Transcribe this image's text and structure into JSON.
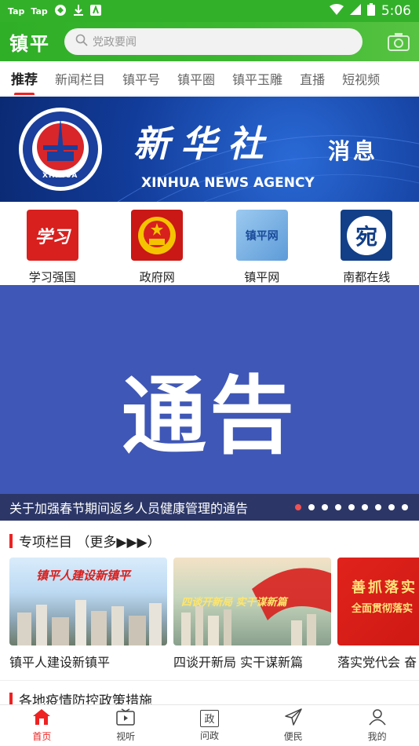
{
  "status_bar": {
    "tap1": "Tap",
    "tap2": "Tap",
    "time": "5:06"
  },
  "header": {
    "logo": "镇平",
    "search_placeholder": "党政要闻"
  },
  "tabs": [
    {
      "label": "推荐",
      "active": true
    },
    {
      "label": "新闻栏目"
    },
    {
      "label": "镇平号"
    },
    {
      "label": "镇平圈"
    },
    {
      "label": "镇平玉雕"
    },
    {
      "label": "直播"
    },
    {
      "label": "短视频"
    }
  ],
  "banner_xinhua": {
    "title": "新华社",
    "message": "消息",
    "english": "XINHUA NEWS AGENCY",
    "emblem_text": "XINHUA"
  },
  "quick_links": [
    {
      "label": "学习强国",
      "icon": "xuexi-icon",
      "icon_text": "学习"
    },
    {
      "label": "政府网",
      "icon": "national-emblem-icon"
    },
    {
      "label": "镇平网",
      "icon": "zhenping-net-icon",
      "icon_text": "镇平网"
    },
    {
      "label": "南都在线",
      "icon": "nandu-icon",
      "icon_text": "宛"
    }
  ],
  "carousel": {
    "image_text": "通告",
    "caption": "关于加强春节期间返乡人员健康管理的通告",
    "dot_count": 9,
    "active_dot": 0
  },
  "special_section": {
    "title": "专项栏目 （更多▶▶▶）",
    "cards": [
      {
        "title": "镇平人建设新镇平",
        "image_text": "镇平人建设新镇平"
      },
      {
        "title": "四谈开新局 实干谋新篇",
        "image_text": "四谈开新局 实干谋新篇"
      },
      {
        "title": "落实党代会 奋",
        "image_text_1": "善抓落实",
        "image_text_2": "全面贯彻落实"
      }
    ]
  },
  "policy_section": {
    "title": "各地疫情防控政策措施"
  },
  "bottom_nav": [
    {
      "label": "首页",
      "icon": "home-icon",
      "active": true
    },
    {
      "label": "视听",
      "icon": "video-icon"
    },
    {
      "label": "问政",
      "icon": "inquiry-icon",
      "icon_text": "政"
    },
    {
      "label": "便民",
      "icon": "send-icon"
    },
    {
      "label": "我的",
      "icon": "user-icon"
    }
  ],
  "colors": {
    "brand_green": "#33b02a",
    "accent_red": "#e22222",
    "banner_blue": "#3f57b6",
    "xinhua_blue": "#123c9a"
  }
}
